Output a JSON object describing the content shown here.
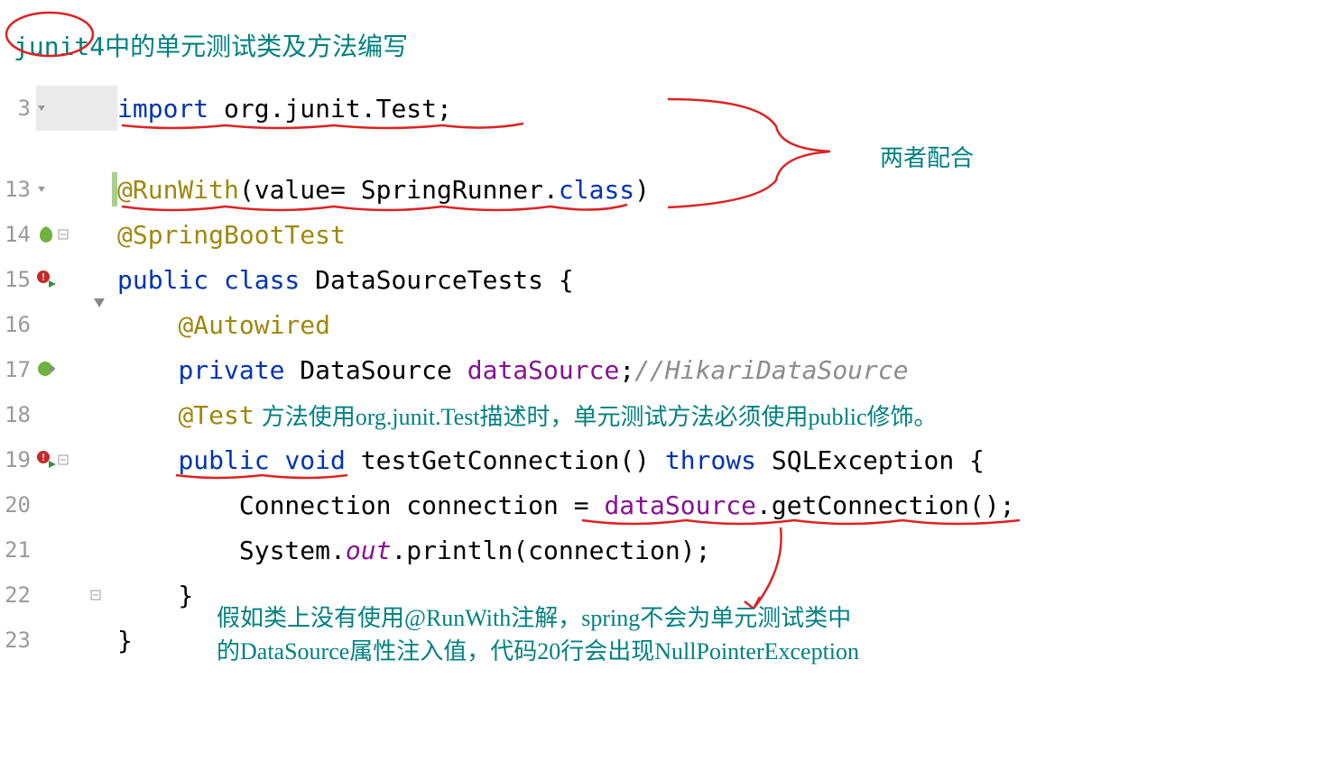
{
  "title": {
    "circled": "junit4",
    "rest": "中的单元测试类及方法编写"
  },
  "annotations": {
    "note1": "两者配合",
    "note2": "方法使用org.junit.Test描述时，单元测试方法必须使用public修饰。",
    "note3_line1": "假如类上没有使用@RunWith注解，spring不会为单元测试类中",
    "note3_line2": "的DataSource属性注入值，代码20行会出现NullPointerException"
  },
  "lines": {
    "l3": {
      "num": "3",
      "tokens": [
        {
          "t": "import",
          "c": "kw"
        },
        {
          "t": " org.junit.",
          "c": ""
        },
        {
          "t": "Test",
          "c": "cls"
        },
        {
          "t": ";",
          "c": ""
        }
      ]
    },
    "l13": {
      "num": "13",
      "tokens": [
        {
          "t": "@RunWith",
          "c": "ann"
        },
        {
          "t": "(value= SpringRunner.",
          "c": ""
        },
        {
          "t": "class",
          "c": "kw"
        },
        {
          "t": ")",
          "c": ""
        }
      ]
    },
    "l14": {
      "num": "14",
      "tokens": [
        {
          "t": "@SpringBootTest",
          "c": "ann"
        }
      ]
    },
    "l15": {
      "num": "15",
      "tokens": [
        {
          "t": "public class ",
          "c": "kw"
        },
        {
          "t": "DataSourceTests {",
          "c": ""
        }
      ]
    },
    "l16": {
      "num": "16",
      "tokens": [
        {
          "t": "    ",
          "c": ""
        },
        {
          "t": "@Autowired",
          "c": "ann"
        }
      ]
    },
    "l17": {
      "num": "17",
      "tokens": [
        {
          "t": "    ",
          "c": ""
        },
        {
          "t": "private ",
          "c": "kw"
        },
        {
          "t": "DataSource ",
          "c": ""
        },
        {
          "t": "dataSource",
          "c": "fld"
        },
        {
          "t": ";",
          "c": ""
        },
        {
          "t": "//HikariDataSource",
          "c": "cmt"
        }
      ]
    },
    "l18": {
      "num": "18",
      "tokens": [
        {
          "t": "    ",
          "c": ""
        },
        {
          "t": "@Test",
          "c": "ann"
        }
      ]
    },
    "l19": {
      "num": "19",
      "tokens": [
        {
          "t": "    ",
          "c": ""
        },
        {
          "t": "public void ",
          "c": "kw"
        },
        {
          "t": "testGetConnection",
          "c": ""
        },
        {
          "t": "() ",
          "c": ""
        },
        {
          "t": "throws ",
          "c": "kw"
        },
        {
          "t": "SQLException {",
          "c": ""
        }
      ]
    },
    "l20": {
      "num": "20",
      "tokens": [
        {
          "t": "        Connection connection = ",
          "c": ""
        },
        {
          "t": "dataSource",
          "c": "fld"
        },
        {
          "t": ".getConnection();",
          "c": ""
        }
      ]
    },
    "l21": {
      "num": "21",
      "tokens": [
        {
          "t": "        System.",
          "c": ""
        },
        {
          "t": "out",
          "c": "stat"
        },
        {
          "t": ".println(connection);",
          "c": ""
        }
      ]
    },
    "l22": {
      "num": "22",
      "tokens": [
        {
          "t": "    }",
          "c": ""
        }
      ]
    },
    "l23": {
      "num": "23",
      "tokens": [
        {
          "t": "}",
          "c": ""
        }
      ]
    }
  }
}
